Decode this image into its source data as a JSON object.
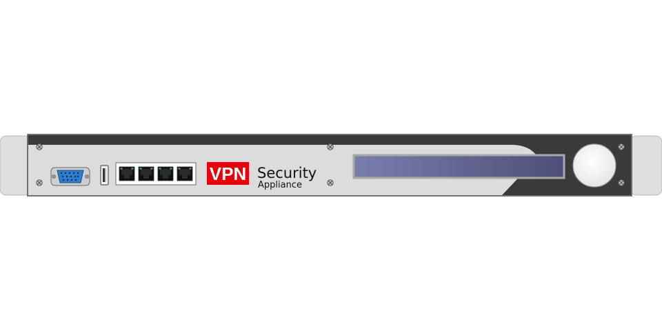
{
  "device": {
    "badge": "VPN",
    "title": "Security",
    "subtitle": "Appliance",
    "port_count": 4
  },
  "colors": {
    "badge_red": "#e8000b",
    "chassis_light": "#dcdcdc",
    "panel_dark": "#3a3a3a",
    "lcd_left": "#7a7eab",
    "lcd_right": "#4e4f78",
    "vga_blue": "#2c7fd0",
    "power_button": "#f4f4f4"
  },
  "icons": [
    "vga-port-icon",
    "usb-port-icon",
    "ethernet-port-icon",
    "screw-icon",
    "power-button-icon"
  ]
}
